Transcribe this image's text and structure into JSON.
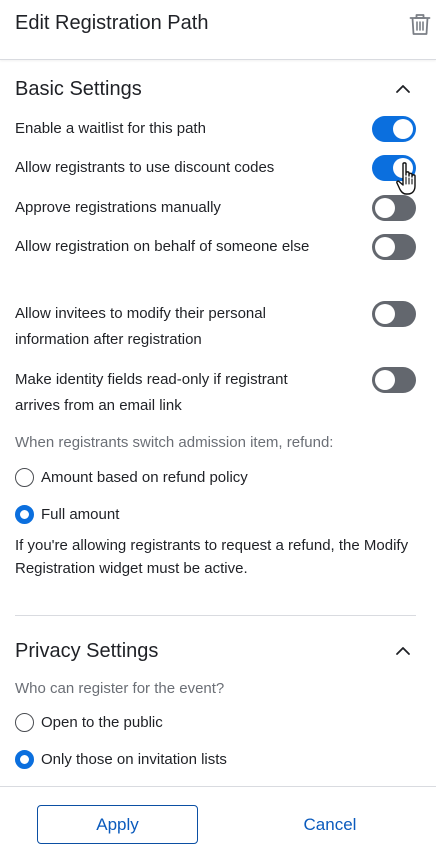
{
  "header": {
    "title": "Edit Registration Path"
  },
  "basic_settings": {
    "title": "Basic Settings",
    "toggles": [
      {
        "label": "Enable a waitlist for this path",
        "on": true
      },
      {
        "label": "Allow registrants to use discount codes",
        "on": true
      },
      {
        "label": "Approve registrations manually",
        "on": false
      },
      {
        "label": "Allow registration on behalf of someone else",
        "on": false
      },
      {
        "label": "Allow invitees to modify their personal information after registration",
        "on": false
      },
      {
        "label": "Make identity fields read-only if registrant arrives from an email link",
        "on": false
      }
    ],
    "refund_question": "When registrants switch admission item, refund:",
    "refund_options": [
      {
        "label": "Amount based on refund policy",
        "selected": false
      },
      {
        "label": "Full amount",
        "selected": true
      }
    ],
    "refund_note": "If you're allowing registrants to request a refund, the Modify Registration widget must be active."
  },
  "privacy_settings": {
    "title": "Privacy Settings",
    "question": "Who can register for the event?",
    "options": [
      {
        "label": "Open to the public",
        "selected": false
      },
      {
        "label": "Only those on invitation lists",
        "selected": true
      }
    ]
  },
  "footer": {
    "apply_label": "Apply",
    "cancel_label": "Cancel"
  },
  "colors": {
    "accent": "#0b6fde",
    "toggle_off": "#63676e"
  },
  "icons": {
    "delete": "trash-icon",
    "collapse": "chevron-up-icon",
    "pointer": "hand-pointer-icon"
  }
}
